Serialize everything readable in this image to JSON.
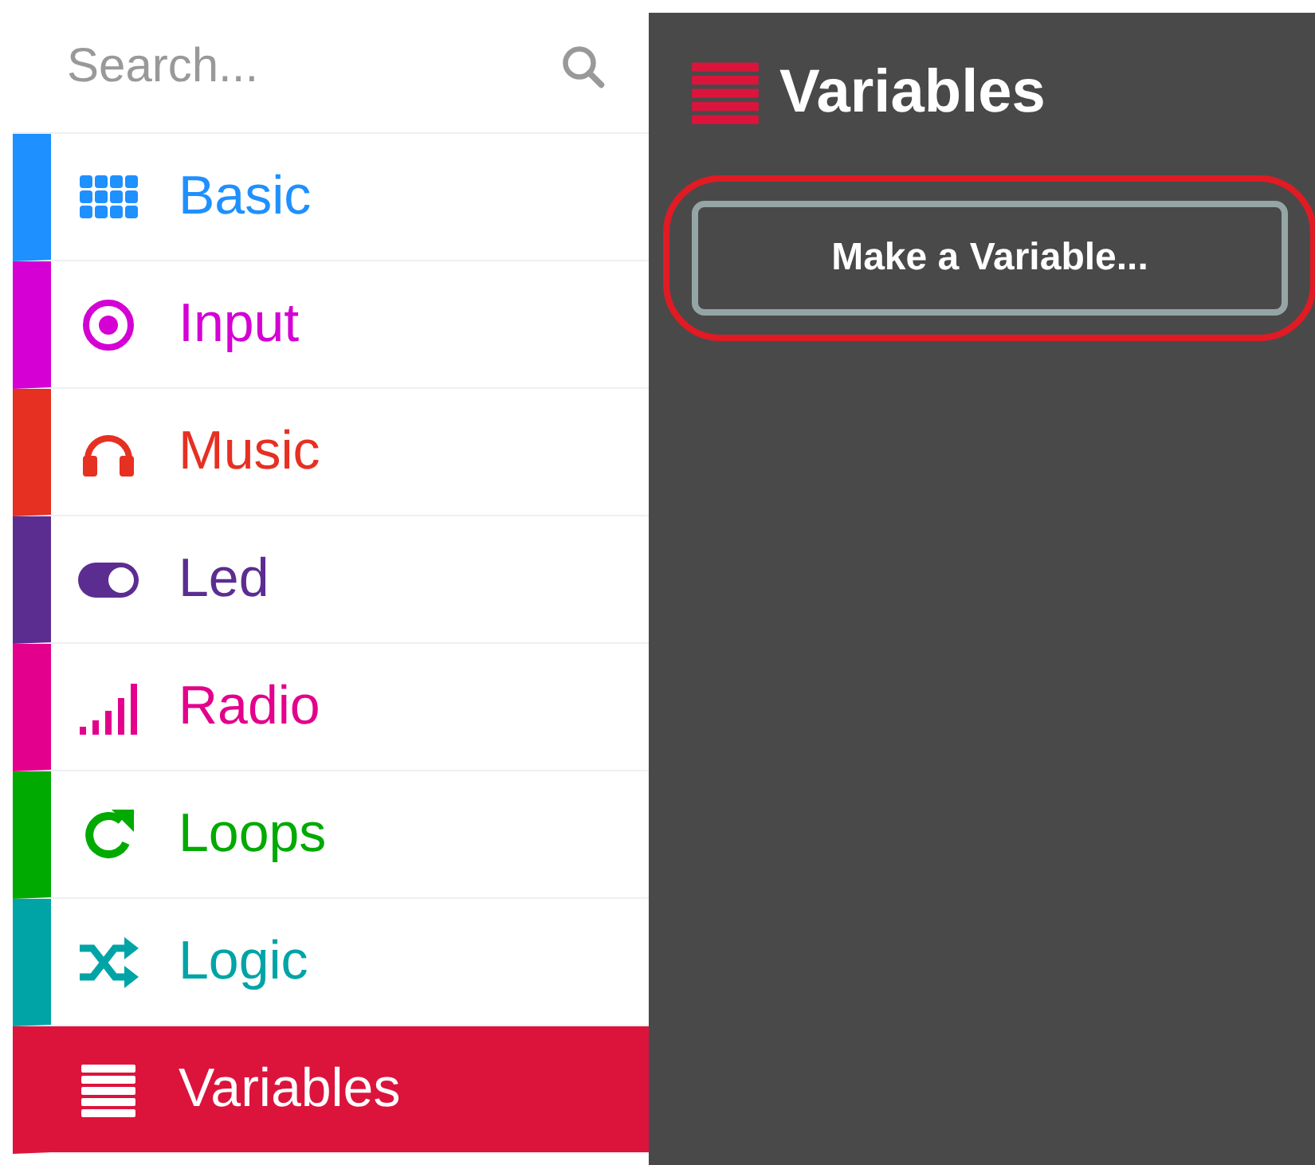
{
  "search": {
    "placeholder": "Search..."
  },
  "categories": [
    {
      "label": "Basic",
      "kind": "grid",
      "color": "#1e90ff",
      "selected": false
    },
    {
      "label": "Input",
      "kind": "target",
      "color": "#d400d4",
      "selected": false
    },
    {
      "label": "Music",
      "kind": "headphones",
      "color": "#e63022",
      "selected": false
    },
    {
      "label": "Led",
      "kind": "toggle",
      "color": "#5c2d91",
      "selected": false
    },
    {
      "label": "Radio",
      "kind": "signal",
      "color": "#e3008c",
      "selected": false
    },
    {
      "label": "Loops",
      "kind": "loop",
      "color": "#00aa00",
      "selected": false
    },
    {
      "label": "Logic",
      "kind": "shuffle",
      "color": "#00a4a6",
      "selected": false
    },
    {
      "label": "Variables",
      "kind": "lines",
      "color": "#dc143c",
      "selected": true
    }
  ],
  "flyout": {
    "title": "Variables",
    "button": "Make a Variable...",
    "button_highlighted": true
  }
}
